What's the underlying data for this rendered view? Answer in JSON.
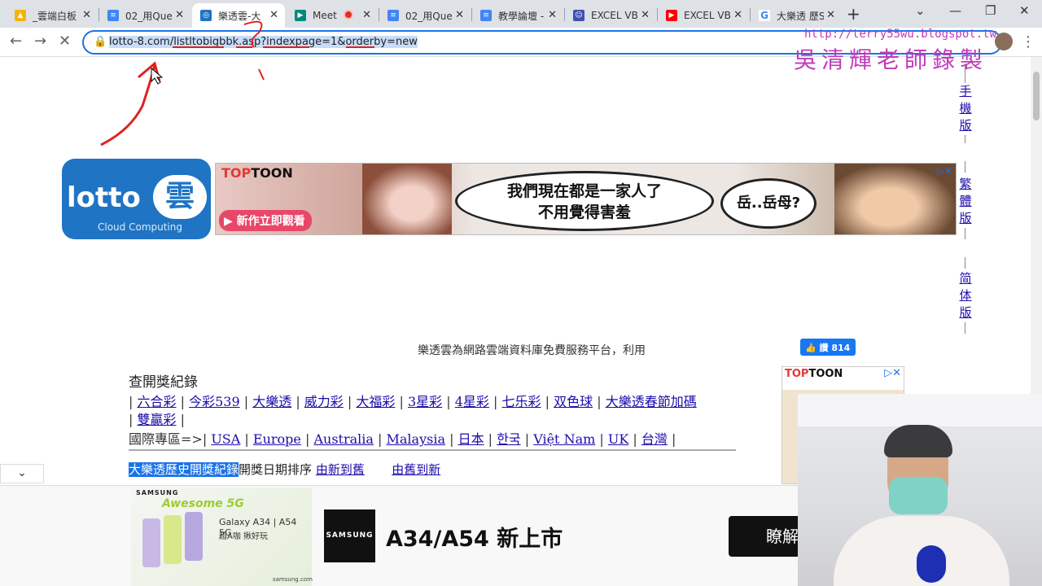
{
  "tabs": [
    {
      "label": "_雲端白板",
      "icon": "google-drive-icon",
      "color": "#f4b400",
      "active": false
    },
    {
      "label": "02_用Que",
      "icon": "google-docs-icon",
      "color": "#4285f4",
      "active": false
    },
    {
      "label": "樂透雲-大",
      "icon": "lotto-icon",
      "color": "#1f74c4",
      "active": true
    },
    {
      "label": "Meet",
      "icon": "google-meet-icon",
      "color": "#00897b",
      "active": false
    },
    {
      "label": "02_用Que",
      "icon": "google-docs-icon",
      "color": "#4285f4",
      "active": false
    },
    {
      "label": "教學論壇 -",
      "icon": "google-docs-icon",
      "color": "#4285f4",
      "active": false
    },
    {
      "label": "EXCEL VB/",
      "icon": "people-icon",
      "color": "#3f51b5",
      "active": false
    },
    {
      "label": "EXCEL VB/",
      "icon": "youtube-icon",
      "color": "#ff0000",
      "active": false
    },
    {
      "label": "大樂透 歷S",
      "icon": "google-icon",
      "color": "#34a853",
      "active": false
    }
  ],
  "toolbar": {
    "url": "lotto-8.com/listltobigbbk.asp?indexpage=1&orderby=new"
  },
  "annotation": {
    "blog": "http://terry55wu.blogspot.tw",
    "teacher": "吳清輝老師錄製"
  },
  "logo": {
    "main": "lotto",
    "cloud_char": "雲",
    "sub": "Cloud Computing"
  },
  "banner": {
    "brand_a": "TOP",
    "brand_b": "TOON",
    "button": "新作立即觀看",
    "bubble1_line1": "我們現在都是一家人了",
    "bubble1_line2": "不用覺得害羞",
    "bubble2": "岳..岳母?"
  },
  "side_versions": [
    {
      "label": "手機版"
    },
    {
      "label": "繁體版"
    },
    {
      "label": "简体版"
    }
  ],
  "slogan": "樂透雲為網路雲端資料庫免費服務平台，利用",
  "fb_like": "讚 814",
  "record_heading": "查開獎紀錄",
  "lottery_links_1": [
    "六合彩",
    "今彩539",
    "大樂透",
    "威力彩",
    "大福彩",
    "3星彩",
    "4星彩",
    "七乐彩",
    "双色球",
    "大樂透春節加碼"
  ],
  "lottery_links_2": [
    "雙贏彩"
  ],
  "intl_label": "國際專區=>",
  "intl_links": [
    "USA",
    "Europe",
    "Australia",
    "Malaysia",
    "日本",
    "한국",
    "Việt Nam",
    "UK",
    "台灣"
  ],
  "history": {
    "highlight": "大樂透歷史開獎紀錄",
    "sort_label": "開獎日期排序",
    "new_to_old": "由新到舊",
    "old_to_new": "由舊到新"
  },
  "side_ad": {
    "brand_a": "TOP",
    "brand_b": "TOON"
  },
  "bottom_ad": {
    "brand": "SAMSUNG",
    "awesome": "Awesome 5G",
    "model": "Galaxy A34 | A54 5G",
    "sub": "超A咖 揪好玩",
    "url": "samsung.com",
    "logo": "SAMSUNG",
    "title": "A34/A54 新上市",
    "button": "瞭解"
  }
}
